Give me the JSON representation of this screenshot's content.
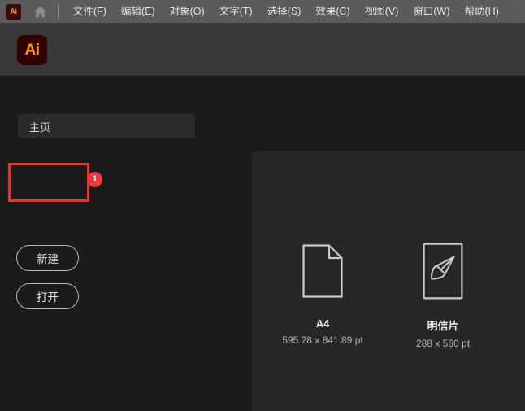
{
  "menubar": {
    "app_badge": "Ai",
    "home_icon": "home-icon",
    "items": [
      {
        "label": "文件(F)"
      },
      {
        "label": "编辑(E)"
      },
      {
        "label": "对象(O)"
      },
      {
        "label": "文字(T)"
      },
      {
        "label": "选择(S)"
      },
      {
        "label": "效果(C)"
      },
      {
        "label": "视图(V)"
      },
      {
        "label": "窗口(W)"
      },
      {
        "label": "帮助(H)"
      }
    ]
  },
  "header": {
    "logo_text": "Ai"
  },
  "sidebar": {
    "home_field": {
      "value": "主页"
    },
    "buttons": [
      {
        "label": "新建"
      },
      {
        "label": "打开"
      }
    ]
  },
  "annotation": {
    "badge_number": "1",
    "highlight_color": "#f12d2d",
    "badge_color": "#f0383c"
  },
  "content": {
    "templates": [
      {
        "name": "A4",
        "dimensions": "595.28 x 841.89 pt",
        "icon": "document-page-icon"
      },
      {
        "name": "明信片",
        "dimensions": "288 x 560 pt",
        "icon": "paintbrush-card-icon"
      }
    ]
  },
  "colors": {
    "menubar_bg": "#5b5b5b",
    "header_bg": "#383838",
    "sidebar_bg": "#1b1b1b",
    "panel_bg": "#272727",
    "logo_orange": "#ff9a00",
    "logo_maroon": "#330000"
  }
}
